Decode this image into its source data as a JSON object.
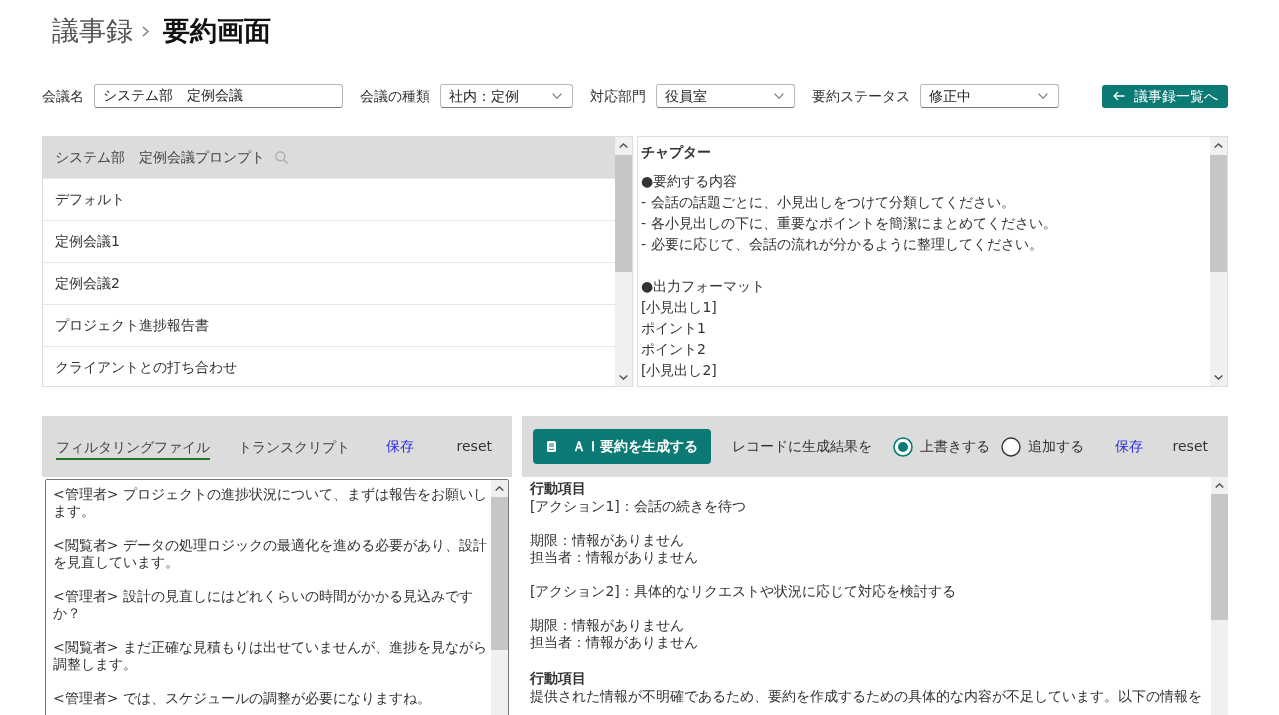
{
  "breadcrumb": [
    {
      "label": "議事録",
      "current": false
    },
    {
      "label": "要約画面",
      "current": true
    }
  ],
  "filters": [
    {
      "kind": "text",
      "label": "会議名",
      "value": "システム部　定例会議"
    },
    {
      "kind": "select",
      "label": "会議の種類",
      "value": "社内：定例"
    },
    {
      "kind": "select",
      "label": "対応部門",
      "value": "役員室"
    },
    {
      "kind": "select",
      "label": "要約ステータス",
      "value": "修正中"
    }
  ],
  "back_button": {
    "label": "議事録一覧へ"
  },
  "prompt_list": {
    "title": "システム部　定例会議プロンプト",
    "items": [
      {
        "label": "デフォルト"
      },
      {
        "label": "定例会議1"
      },
      {
        "label": "定例会議2"
      },
      {
        "label": "プロジェクト進捗報告書"
      },
      {
        "label": "クライアントとの打ち合わせ"
      }
    ]
  },
  "chapter": {
    "title": "チャプター",
    "blocks": [
      [
        "●要約する内容",
        "- 会話の話題ごとに、小見出しをつけて分類してください。",
        "- 各小見出しの下に、重要なポイントを簡潔にまとめてください。",
        "- 必要に応じて、会話の流れが分かるように整理してください。"
      ],
      [
        "●出力フォーマット",
        "[小見出し1]",
        "ポイント1",
        "ポイント2",
        "[小見出し2]"
      ]
    ]
  },
  "source_panel": {
    "tabs": [
      {
        "label": "フィルタリングファイル",
        "selected": true
      },
      {
        "label": "トランスクリプト",
        "selected": false
      }
    ],
    "save_link": {
      "label": "保存"
    },
    "reset_link": {
      "label": "reset"
    },
    "entries": [
      "<管理者> プロジェクトの進捗状況について、まずは報告をお願いします。",
      "<閲覧者> データの処理ロジックの最適化を進める必要があり、設計を見直しています。",
      "<管理者> 設計の見直しにはどれくらいの時間がかかる見込みですか？",
      "<閲覧者> まだ正確な見積もりは出せていませんが、進捗を見ながら調整します。",
      "<管理者> では、スケジュールの調整が必要になりますね。"
    ]
  },
  "summary_panel": {
    "generate_button": {
      "label": "ＡＩ要約を生成する"
    },
    "mode_label": "レコードに生成結果を",
    "modes": [
      {
        "label": "上書きする",
        "selected": true
      },
      {
        "label": "追加する",
        "selected": false
      }
    ],
    "save_link": {
      "label": "保存"
    },
    "reset_link": {
      "label": "reset"
    },
    "sections": [
      {
        "heading": "行動項目",
        "paragraphs": [
          [
            "[アクション1]：会話の続きを待つ"
          ],
          [
            "期限：情報がありません",
            "担当者：情報がありません"
          ],
          [
            "[アクション2]：具体的なリクエストや状況に応じて対応を検討する"
          ],
          [
            "期限：情報がありません",
            "担当者：情報がありません"
          ]
        ]
      },
      {
        "heading": "行動項目",
        "paragraphs": [
          [
            "提供された情報が不明確であるため、要約を作成するための具体的な内容が不足しています。以下の情報を"
          ]
        ]
      }
    ]
  }
}
